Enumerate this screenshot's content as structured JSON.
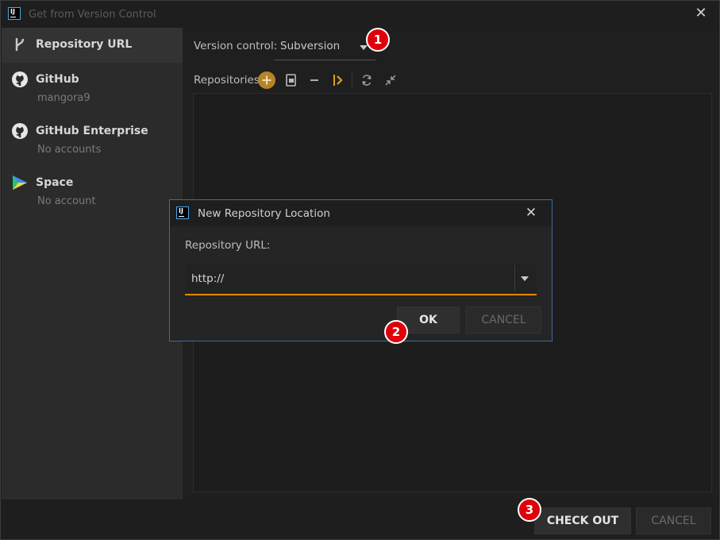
{
  "window": {
    "title": "Get from Version Control",
    "app_logo_text": "IJ"
  },
  "sidebar": {
    "items": [
      {
        "label": "Repository URL",
        "sub": ""
      },
      {
        "label": "GitHub",
        "sub": "mangora9"
      },
      {
        "label": "GitHub Enterprise",
        "sub": "No accounts"
      },
      {
        "label": "Space",
        "sub": "No account"
      }
    ]
  },
  "main": {
    "version_control_label": "Version control:",
    "version_control_value": "Subversion",
    "repositories_label": "Repositories:",
    "toolbar_icons": [
      "add-icon",
      "export-icon",
      "minus-icon",
      "branch-icon",
      "refresh-icon",
      "collapse-icon"
    ]
  },
  "footer": {
    "checkout_label": "CHECK OUT",
    "cancel_label": "CANCEL"
  },
  "dialog": {
    "title": "New Repository Location",
    "logo_text": "IJ",
    "url_label": "Repository URL:",
    "url_value": "http://",
    "ok_label": "OK",
    "cancel_label": "CANCEL"
  },
  "badges": {
    "b1": "1",
    "b2": "2",
    "b3": "3"
  },
  "colors": {
    "accent_orange": "#e08a00",
    "badge_red": "#e0000b",
    "dialog_border": "#3a6da0",
    "add_button": "#b5842a"
  }
}
